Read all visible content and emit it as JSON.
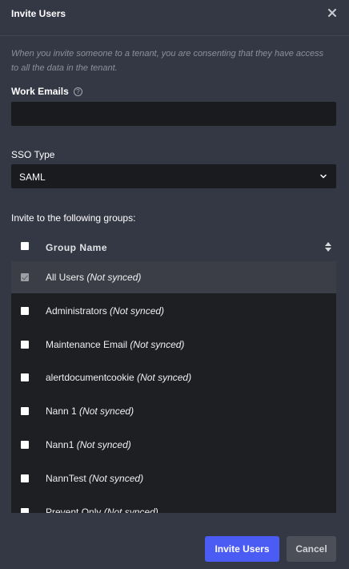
{
  "dialog": {
    "title": "Invite Users",
    "notice": "When you invite someone to a tenant, you are consenting that they have access to all the data in the tenant."
  },
  "form": {
    "emails_label": "Work Emails",
    "emails_value": "",
    "sso_label": "SSO Type",
    "sso_value": "SAML",
    "groups_label": "Invite to the following groups:"
  },
  "table": {
    "header": "Group Name",
    "rows": [
      {
        "name": "All Users",
        "sync": "(Not synced)",
        "checked": true,
        "disabled": true
      },
      {
        "name": "Administrators",
        "sync": "(Not synced)",
        "checked": false
      },
      {
        "name": "Maintenance Email",
        "sync": "(Not synced)",
        "checked": false
      },
      {
        "name": "alertdocumentcookie",
        "sync": "(Not synced)",
        "checked": false
      },
      {
        "name": "Nann 1",
        "sync": "(Not synced)",
        "checked": false
      },
      {
        "name": "Nann1",
        "sync": "(Not synced)",
        "checked": false
      },
      {
        "name": "NannTest",
        "sync": "(Not synced)",
        "checked": false
      },
      {
        "name": "Prevent Only",
        "sync": "(Not synced)",
        "checked": false
      }
    ]
  },
  "buttons": {
    "invite": "Invite Users",
    "cancel": "Cancel"
  },
  "colors": {
    "primary": "#4b5cf5",
    "modal_bg": "#343844",
    "input_bg": "#1a1b1f"
  }
}
